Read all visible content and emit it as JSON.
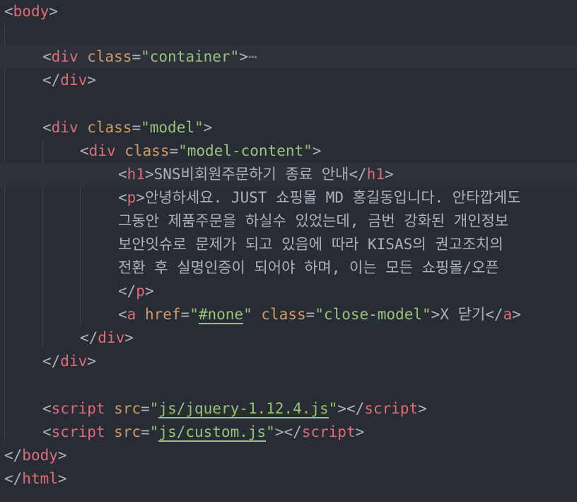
{
  "code": {
    "body_open": "body",
    "container_tag": "div",
    "class_attr": "class",
    "container_value": "\"container\"",
    "fold_marker": "⋯",
    "div_tag": "div",
    "model_value": "\"model\"",
    "model_content_value": "\"model-content\"",
    "h1_tag": "h1",
    "h1_text": "SNS비회원주문하기 종료 안내",
    "p_tag": "p",
    "p_line1": "안녕하세요. JUST 쇼핑몰 MD 홍길동입니다. 안타깝게도",
    "p_line2": "그동안 제품주문을 하실수 있었는데, 금번 강화된 개인정보",
    "p_line3": "보안잇슈로 문제가 되고 있음에 따라 KISAS의 권고조치의",
    "p_line4": "전환 후 실명인증이 되어야 하며, 이는 모든 쇼핑몰/오픈",
    "a_tag": "a",
    "href_attr": "href",
    "href_value": "#none",
    "close_class_value": "\"close-model\"",
    "a_text": "X 닫기",
    "script_tag": "script",
    "src_attr": "src",
    "script1_src": "js/jquery-1.12.4.js",
    "script2_src": "js/custom.js",
    "html_close": "html"
  }
}
